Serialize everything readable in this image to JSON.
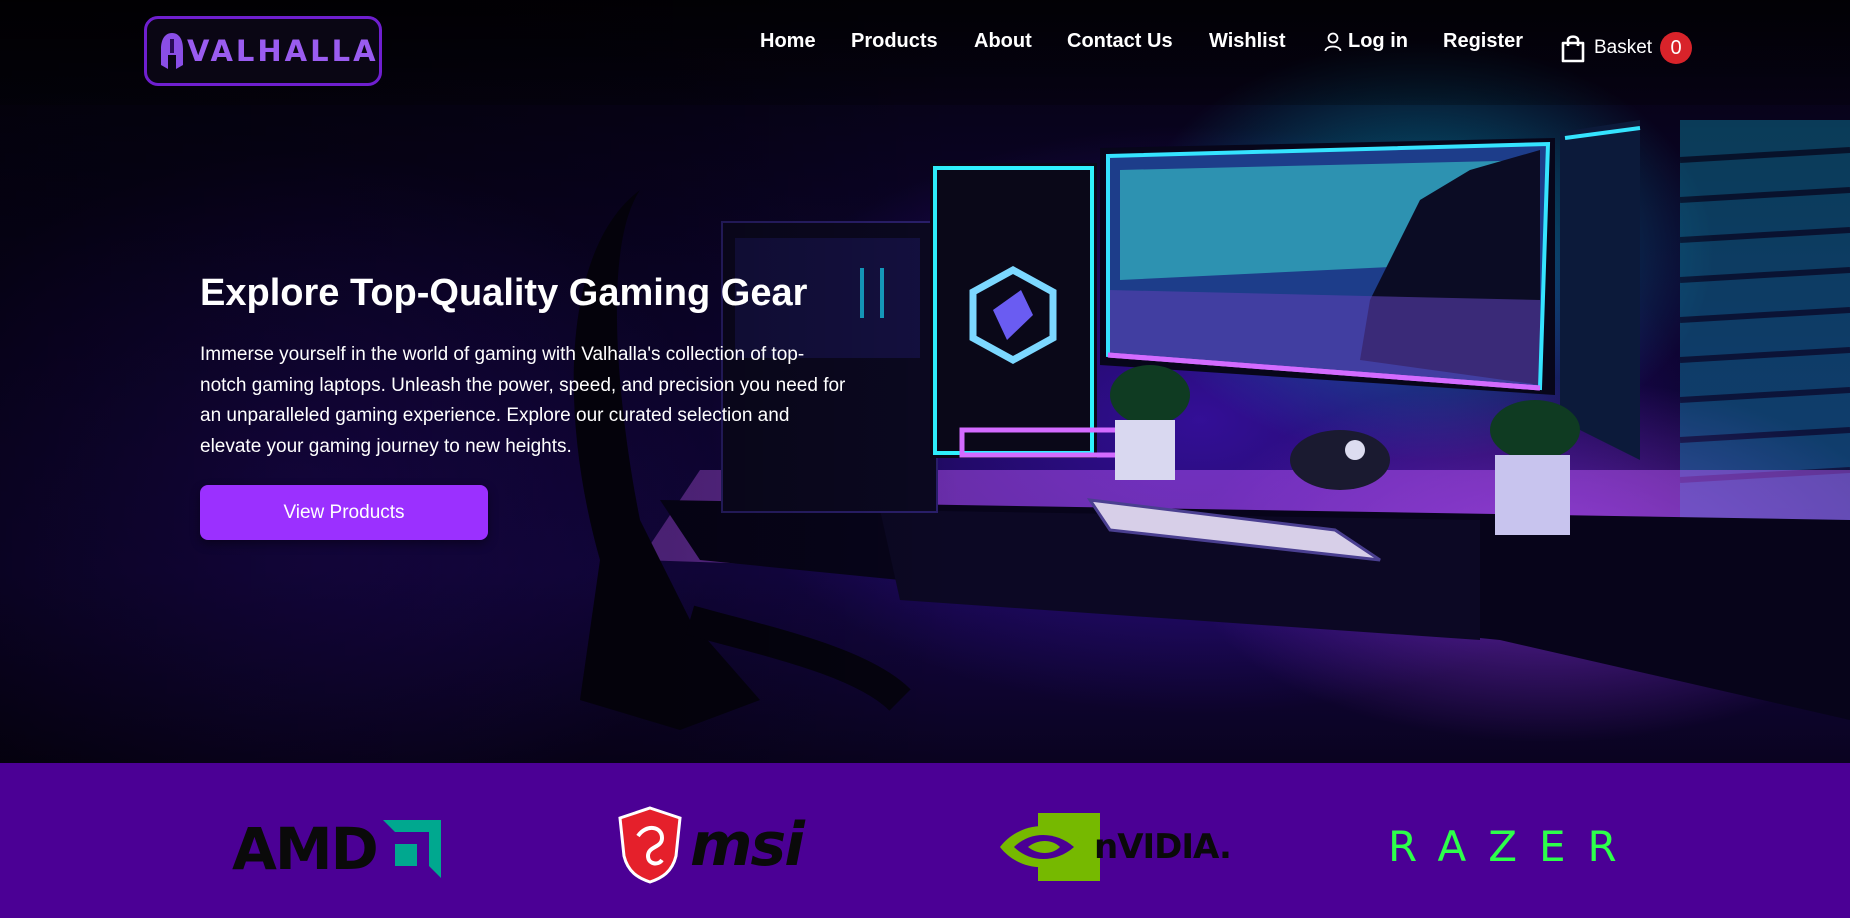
{
  "brand": {
    "name": "VALHALLA"
  },
  "nav": {
    "items": [
      {
        "label": "Home"
      },
      {
        "label": "Products"
      },
      {
        "label": "About"
      },
      {
        "label": "Contact Us"
      },
      {
        "label": "Wishlist"
      },
      {
        "label": "Log in"
      },
      {
        "label": "Register"
      }
    ],
    "basket": {
      "label": "Basket",
      "count": "0"
    }
  },
  "hero": {
    "title": "Explore Top-Quality Gaming Gear",
    "body": "Immerse yourself in the world of gaming with Valhalla's collection of top-notch gaming laptops. Unleash the power, speed, and precision you need for an unparalleled gaming experience. Explore our curated selection and elevate your gaming journey to new heights.",
    "cta_label": "View Products"
  },
  "partners": {
    "amd": "AMD",
    "msi": "msi",
    "nvidia": "nVIDIA.",
    "razer": "RAZER"
  },
  "colors": {
    "accent": "#9b30ff",
    "brand_strip": "#4b0095",
    "badge": "#d8232a",
    "razer_green": "#2dff4a",
    "nvidia_green": "#76b900",
    "amd_teal": "#00a88f",
    "msi_red": "#e5202b"
  },
  "icons": {
    "logo": "spartan-helmet-icon",
    "login": "user-icon",
    "basket": "shopping-bag-icon"
  }
}
